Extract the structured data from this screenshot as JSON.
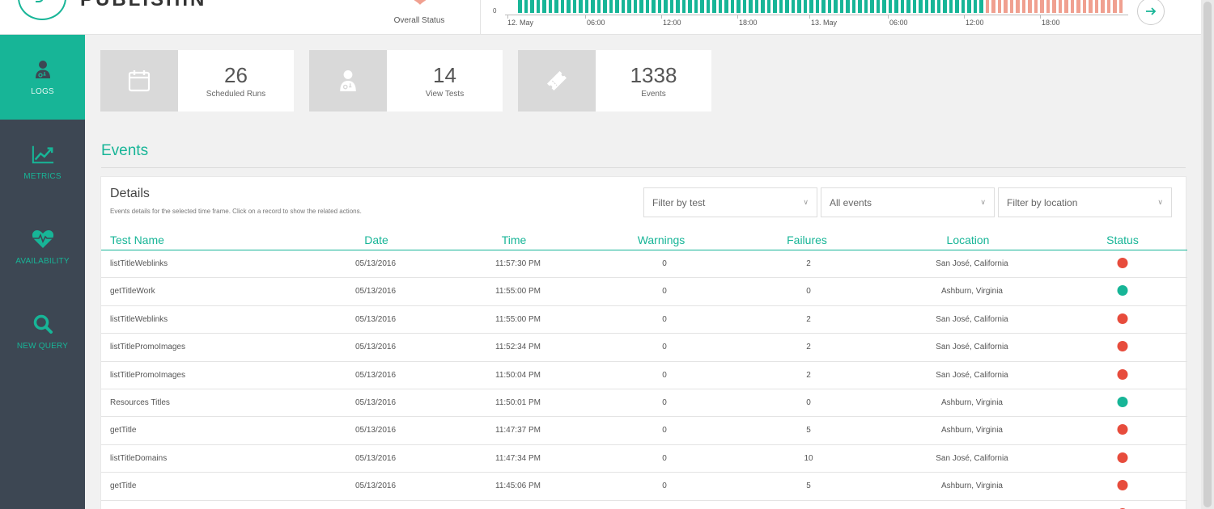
{
  "brand": {
    "name": "PUBLISHIN",
    "accent": "#17b597"
  },
  "header": {
    "overall_status_label": "Overall Status",
    "timeline": {
      "zero_label": "0",
      "x_labels": [
        "12. May",
        "06:00",
        "12:00",
        "18:00",
        "13. May",
        "06:00",
        "12:00",
        "18:00"
      ],
      "ok_color": "#17b597",
      "fail_color": "#f0a090"
    },
    "next_button_icon": "arrow-right-icon"
  },
  "sidebar": {
    "items": [
      {
        "label": "LOGS",
        "icon": "doctor-icon",
        "active": true
      },
      {
        "label": "METRICS",
        "icon": "chart-line-icon",
        "active": false
      },
      {
        "label": "AVAILABILITY",
        "icon": "heartbeat-icon",
        "active": false
      },
      {
        "label": "NEW QUERY",
        "icon": "search-icon",
        "active": false
      }
    ]
  },
  "stats": [
    {
      "value": "26",
      "label": "Scheduled Runs",
      "icon": "calendar-icon"
    },
    {
      "value": "14",
      "label": "View Tests",
      "icon": "doctor-icon"
    },
    {
      "value": "1338",
      "label": "Events",
      "icon": "ticket-icon"
    }
  ],
  "events": {
    "title": "Events",
    "details_title": "Details",
    "details_subtitle": "Events details for the selected time frame. Click on a record to show the related actions.",
    "filters": {
      "test": "Filter by test",
      "events": "All events",
      "location": "Filter by location"
    },
    "columns": [
      "Test Name",
      "Date",
      "Time",
      "Warnings",
      "Failures",
      "Location",
      "Status"
    ],
    "status_colors": {
      "fail": "#e74c3c",
      "ok": "#17b597"
    },
    "rows": [
      {
        "name": "listTitleWeblinks",
        "date": "05/13/2016",
        "time": "11:57:30 PM",
        "warnings": "0",
        "failures": "2",
        "location": "San José, California",
        "status": "fail"
      },
      {
        "name": "getTitleWork",
        "date": "05/13/2016",
        "time": "11:55:00 PM",
        "warnings": "0",
        "failures": "0",
        "location": "Ashburn, Virginia",
        "status": "ok"
      },
      {
        "name": "listTitleWeblinks",
        "date": "05/13/2016",
        "time": "11:55:00 PM",
        "warnings": "0",
        "failures": "2",
        "location": "San José, California",
        "status": "fail"
      },
      {
        "name": "listTitlePromoImages",
        "date": "05/13/2016",
        "time": "11:52:34 PM",
        "warnings": "0",
        "failures": "2",
        "location": "San José, California",
        "status": "fail"
      },
      {
        "name": "listTitlePromoImages",
        "date": "05/13/2016",
        "time": "11:50:04 PM",
        "warnings": "0",
        "failures": "2",
        "location": "San José, California",
        "status": "fail"
      },
      {
        "name": "Resources Titles",
        "date": "05/13/2016",
        "time": "11:50:01 PM",
        "warnings": "0",
        "failures": "0",
        "location": "Ashburn, Virginia",
        "status": "ok"
      },
      {
        "name": "getTitle",
        "date": "05/13/2016",
        "time": "11:47:37 PM",
        "warnings": "0",
        "failures": "5",
        "location": "Ashburn, Virginia",
        "status": "fail"
      },
      {
        "name": "listTitleDomains",
        "date": "05/13/2016",
        "time": "11:47:34 PM",
        "warnings": "0",
        "failures": "10",
        "location": "San José, California",
        "status": "fail"
      },
      {
        "name": "getTitle",
        "date": "05/13/2016",
        "time": "11:45:06 PM",
        "warnings": "0",
        "failures": "5",
        "location": "Ashburn, Virginia",
        "status": "fail"
      },
      {
        "name": "",
        "date": "",
        "time": "",
        "warnings": "",
        "failures": "",
        "location": "",
        "status": "fail"
      }
    ]
  }
}
